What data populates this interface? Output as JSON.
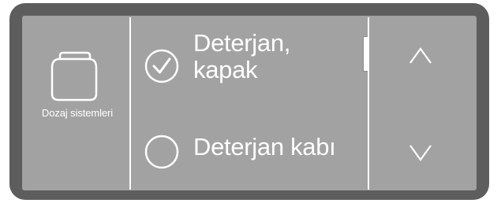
{
  "section": {
    "icon": "canister-icon",
    "label": "Dozaj sistemleri"
  },
  "options": [
    {
      "label_line1": "Deterjan,",
      "label_line2": "kapak",
      "checked": true,
      "icon": "check-circle-icon"
    },
    {
      "label_line1": "Deterjan kabı",
      "label_line2": "",
      "checked": false,
      "icon": "empty-circle-icon"
    }
  ],
  "navigation": {
    "up_icon": "chevron-up-icon",
    "down_icon": "chevron-down-icon"
  },
  "colors": {
    "bezel": "#5d5d5d",
    "screen": "#a2a2a2",
    "foreground": "#ffffff"
  }
}
